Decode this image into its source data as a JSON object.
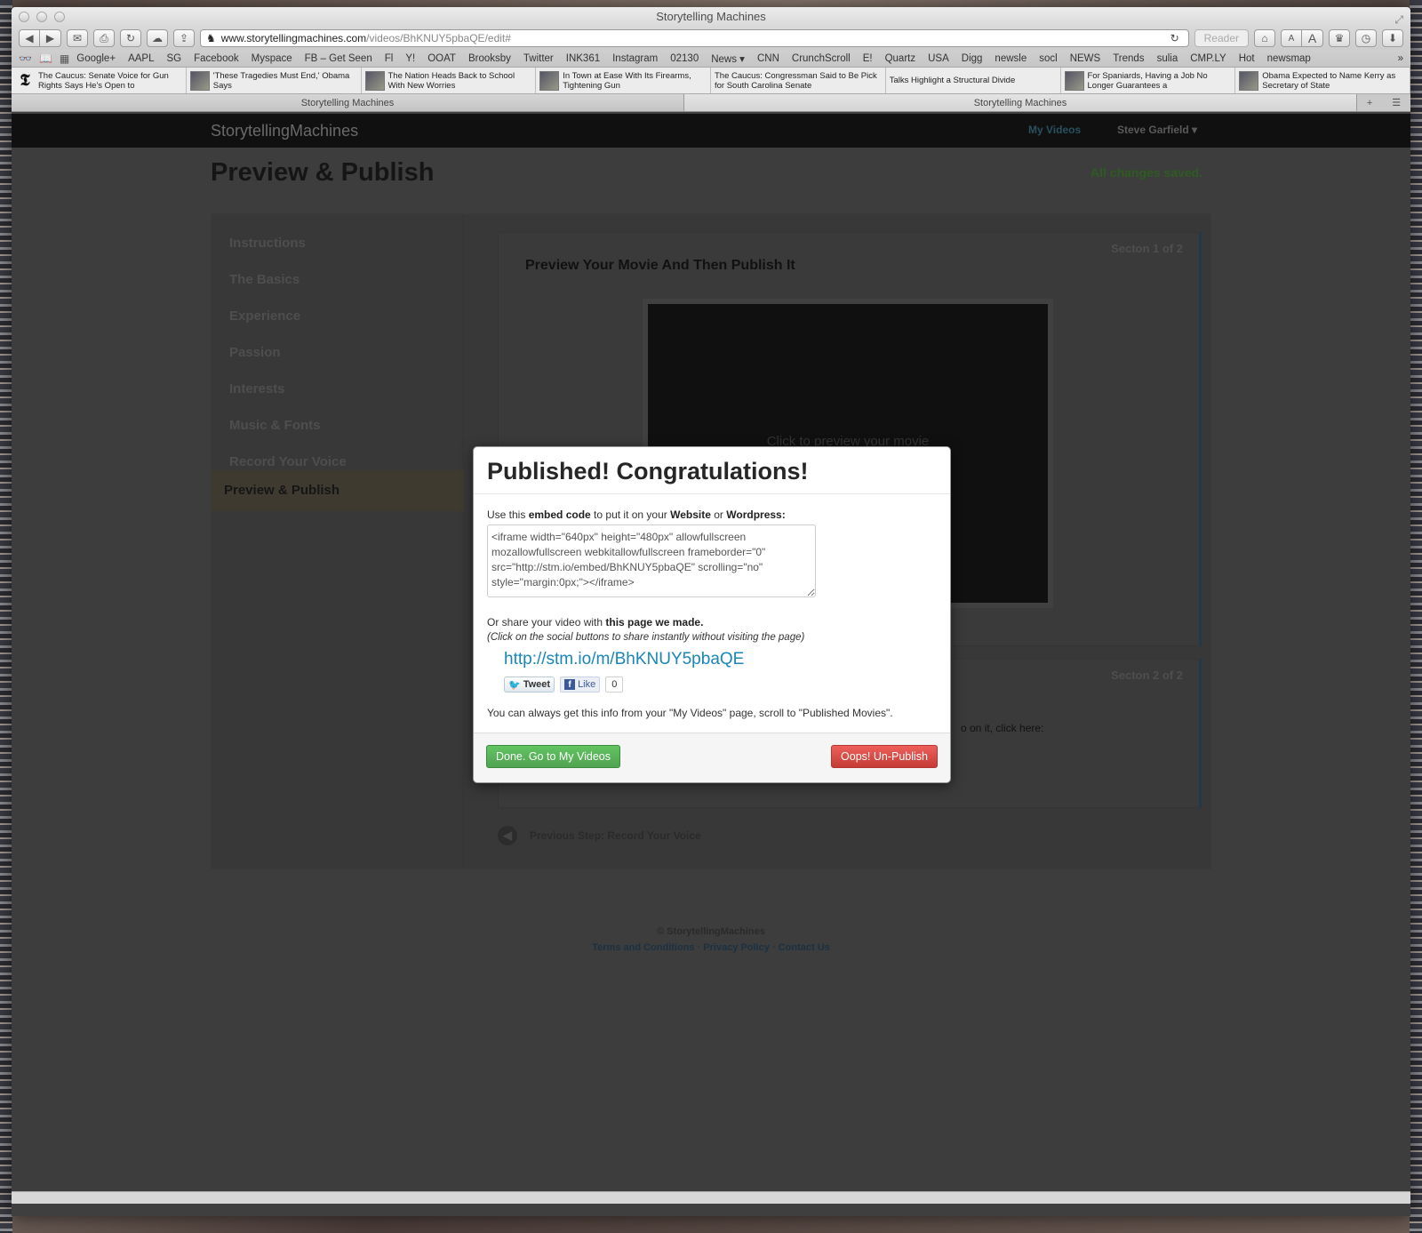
{
  "browser": {
    "window_title": "Storytelling Machines",
    "url_domain": "www.storytellingmachines.com",
    "url_path": "/videos/BhKNUY5pbaQE/edit#",
    "reader_label": "Reader",
    "bookmarks": [
      "Google+",
      "AAPL",
      "SG",
      "Facebook",
      "Myspace",
      "FB – Get Seen",
      "Fl",
      "Y!",
      "OOAT",
      "Brooksby",
      "Twitter",
      "INK361",
      "Instagram",
      "02130",
      "News ▾",
      "CNN",
      "CrunchScroll",
      "E!",
      "Quartz",
      "USA",
      "Digg",
      "newsle",
      "socl",
      "NEWS",
      "Trends",
      "sulia",
      "CMP.LY",
      "Hot",
      "newsmap"
    ],
    "news": [
      "The Caucus: Senate Voice for Gun Rights Says He's Open to",
      "'These Tragedies Must End,' Obama Says",
      "The Nation Heads Back to School With New Worries",
      "In Town at Ease With Its Firearms, Tightening Gun",
      "The Caucus: Congressman Said to Be Pick for South Carolina Senate",
      "Talks Highlight a Structural Divide",
      "For Spaniards, Having a Job No Longer Guarantees a",
      "Obama Expected to Name Kerry as Secretary of State"
    ],
    "tabs": [
      "Storytelling Machines",
      "Storytelling Machines"
    ]
  },
  "site": {
    "brand": "StorytellingMachines",
    "nav_my_videos": "My Videos",
    "nav_user": "Steve Garfield ▾",
    "page_title": "Preview & Publish",
    "saved_status": "All changes saved."
  },
  "sidebar": {
    "items": [
      "Instructions",
      "The Basics",
      "Experience",
      "Passion",
      "Interests",
      "Music & Fonts",
      "Record Your Voice"
    ],
    "active": "Preview & Publish"
  },
  "section1": {
    "label": "Secton 1 of 2",
    "heading": "Preview Your Movie And Then Publish It",
    "video_prompt": "Click to preview your movie"
  },
  "section2": {
    "label": "Secton 2 of 2",
    "partial_text": "o on it, click here:"
  },
  "prev_step": "Previous Step: Record Your Voice",
  "footer": {
    "copyright": "© StorytellingMachines",
    "links": "Terms and Conditions · Privacy Policy · Contact Us"
  },
  "modal": {
    "title": "Published! Congratulations!",
    "embed_intro_1": "Use this ",
    "embed_intro_b1": "embed code",
    "embed_intro_2": " to put it on your ",
    "embed_intro_b2": "Website",
    "embed_intro_3": " or ",
    "embed_intro_b3": "Wordpress:",
    "embed_code": "<iframe width=\"640px\" height=\"480px\" allowfullscreen mozallowfullscreen webkitallowfullscreen frameborder=\"0\" src=\"http://stm.io/embed/BhKNUY5pbaQE\" scrolling=\"no\" style=\"margin:0px;\"></iframe>",
    "share_1": "Or share your video with ",
    "share_b": "this page we made.",
    "share_hint": "(Click on the social buttons to share instantly without visiting the page)",
    "share_url": "http://stm.io/m/BhKNUY5pbaQE",
    "tweet_label": "Tweet",
    "like_label": "Like",
    "like_count": "0",
    "always_text": "You can always get this info from your \"My Videos\" page, scroll to \"Published Movies\".",
    "done_button": "Done. Go to My Videos",
    "unpublish_button": "Oops! Un-Publish"
  }
}
